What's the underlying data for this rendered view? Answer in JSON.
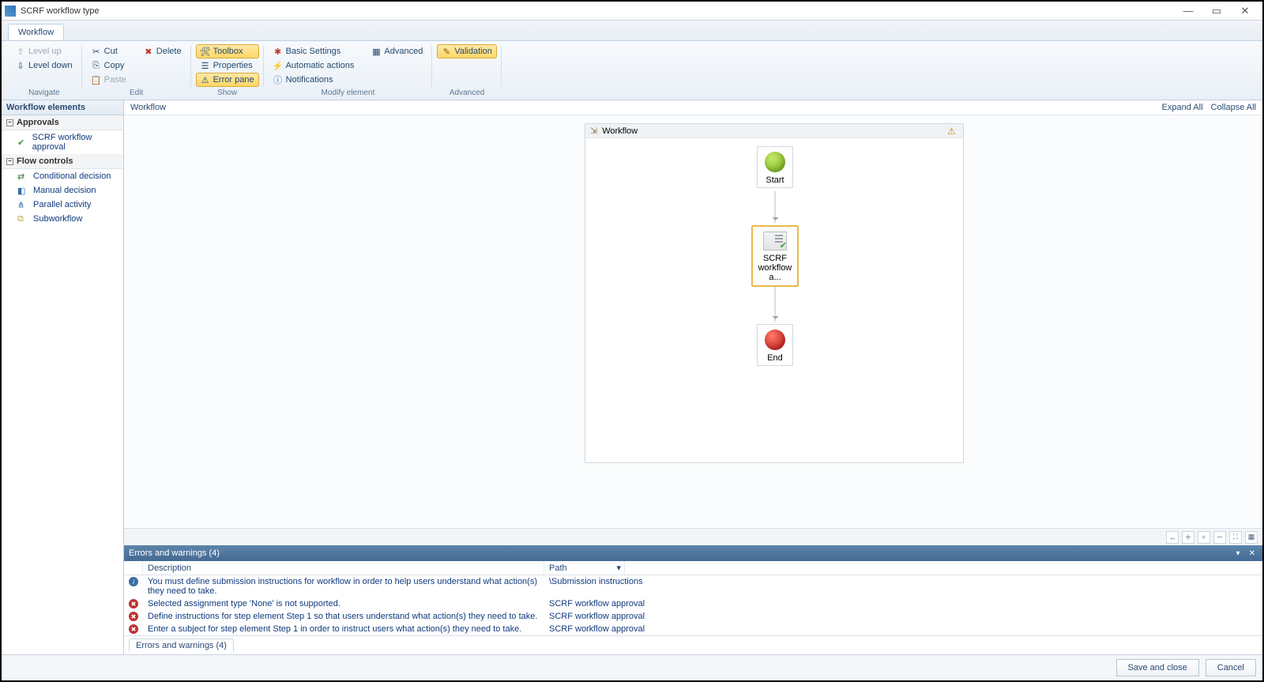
{
  "window": {
    "title": "SCRF workflow type"
  },
  "tabs": {
    "main": "Workflow"
  },
  "ribbon": {
    "navigate": {
      "label": "Navigate",
      "level_up": "Level up",
      "level_down": "Level down"
    },
    "edit": {
      "label": "Edit",
      "cut": "Cut",
      "copy": "Copy",
      "paste": "Paste",
      "delete": "Delete"
    },
    "show": {
      "label": "Show",
      "toolbox": "Toolbox",
      "properties": "Properties",
      "error_pane": "Error pane"
    },
    "modify": {
      "label": "Modify element",
      "basic_settings": "Basic Settings",
      "automatic_actions": "Automatic actions",
      "notifications": "Notifications",
      "advanced": "Advanced"
    },
    "advanced": {
      "label": "Advanced",
      "validation": "Validation"
    }
  },
  "sidebar": {
    "title": "Workflow elements",
    "approvals": {
      "label": "Approvals",
      "items": [
        "SCRF workflow approval"
      ]
    },
    "flow_controls": {
      "label": "Flow controls",
      "items": [
        "Conditional decision",
        "Manual decision",
        "Parallel activity",
        "Subworkflow"
      ]
    }
  },
  "breadcrumb": {
    "root": "Workflow",
    "expand_all": "Expand All",
    "collapse_all": "Collapse All"
  },
  "canvas": {
    "container_title": "Workflow",
    "start_label": "Start",
    "activity_label": "SCRF workflow a...",
    "end_label": "End"
  },
  "errors": {
    "title": "Errors and warnings (4)",
    "tab": "Errors and warnings (4)",
    "columns": {
      "description": "Description",
      "path": "Path"
    },
    "rows": [
      {
        "type": "info",
        "desc": "You must define submission instructions for workflow  in order to help users understand what action(s) they need to take.",
        "path": "\\Submission instructions"
      },
      {
        "type": "error",
        "desc": "Selected assignment type 'None' is not supported.",
        "path": "SCRF workflow approval"
      },
      {
        "type": "error",
        "desc": "Define instructions for step element Step 1 so that users understand what action(s) they need to take.",
        "path": "SCRF workflow approval"
      },
      {
        "type": "error",
        "desc": "Enter a subject for step element Step 1 in order to instruct users what action(s) they need to take.",
        "path": "SCRF workflow approval"
      }
    ]
  },
  "footer": {
    "save_close": "Save and close",
    "cancel": "Cancel"
  }
}
